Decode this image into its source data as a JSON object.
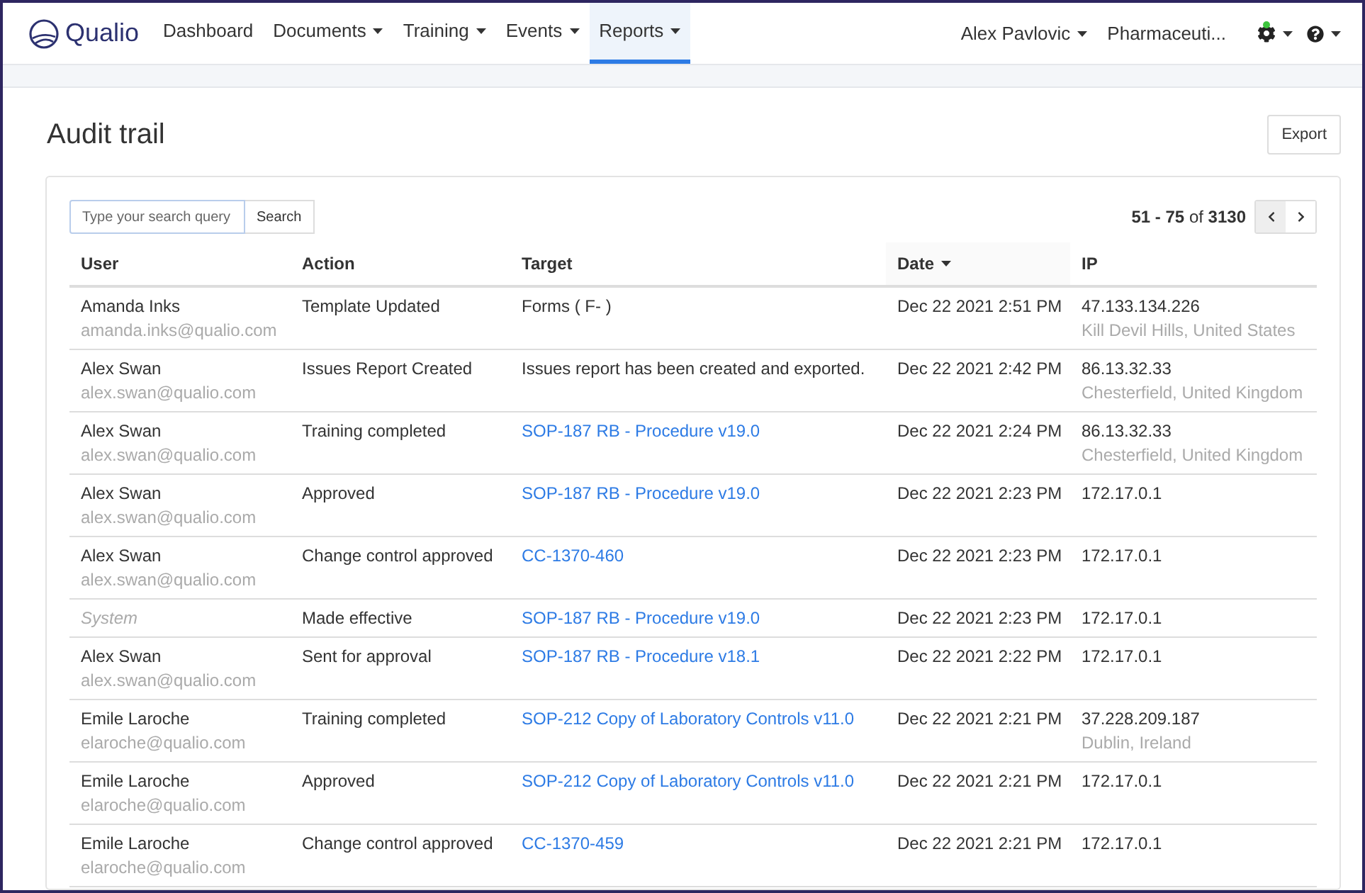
{
  "nav": {
    "brand": "Qualio",
    "items": [
      {
        "label": "Dashboard",
        "dropdown": false,
        "selected": false
      },
      {
        "label": "Documents",
        "dropdown": true,
        "selected": false
      },
      {
        "label": "Training",
        "dropdown": true,
        "selected": false
      },
      {
        "label": "Events",
        "dropdown": true,
        "selected": false
      },
      {
        "label": "Reports",
        "dropdown": true,
        "selected": true
      }
    ],
    "user": "Alex Pavlovic",
    "company": "Pharmaceuti...",
    "settings_notification": true
  },
  "page": {
    "title": "Audit trail",
    "export_button": "Export"
  },
  "search": {
    "placeholder": "Type your search query",
    "button": "Search"
  },
  "pagination": {
    "range": "**51 - 75** of **3130**",
    "prev_disabled": true
  },
  "table": {
    "columns": [
      {
        "label": "User",
        "sorted": false
      },
      {
        "label": "Action",
        "sorted": false
      },
      {
        "label": "Target",
        "sorted": false
      },
      {
        "label": "Date",
        "sorted": true
      },
      {
        "label": "IP",
        "sorted": false
      }
    ],
    "rows": [
      {
        "user": {
          "kind": "person",
          "name": "Amanda Inks",
          "email": "amanda.inks@qualio.com"
        },
        "action": "Template Updated",
        "target": {
          "kind": "text",
          "label": "Forms ( F- )"
        },
        "date": "Dec 22 2021 2:51 PM",
        "ip": "47.133.134.226",
        "location": "Kill Devil Hills, United States"
      },
      {
        "user": {
          "kind": "person",
          "name": "Alex Swan",
          "email": "alex.swan@qualio.com"
        },
        "action": "Issues Report Created",
        "target": {
          "kind": "text",
          "label": "Issues report has been created and exported."
        },
        "date": "Dec 22 2021 2:42 PM",
        "ip": "86.13.32.33",
        "location": "Chesterfield, United Kingdom"
      },
      {
        "user": {
          "kind": "person",
          "name": "Alex Swan",
          "email": "alex.swan@qualio.com"
        },
        "action": "Training completed",
        "target": {
          "kind": "link",
          "label": "SOP-187 RB - Procedure v19.0"
        },
        "date": "Dec 22 2021 2:24 PM",
        "ip": "86.13.32.33",
        "location": "Chesterfield, United Kingdom"
      },
      {
        "user": {
          "kind": "person",
          "name": "Alex Swan",
          "email": "alex.swan@qualio.com"
        },
        "action": "Approved",
        "target": {
          "kind": "link",
          "label": "SOP-187 RB - Procedure v19.0"
        },
        "date": "Dec 22 2021 2:23 PM",
        "ip": "172.17.0.1"
      },
      {
        "user": {
          "kind": "person",
          "name": "Alex Swan",
          "email": "alex.swan@qualio.com"
        },
        "action": "Change control approved",
        "target": {
          "kind": "link",
          "label": "CC-1370-460"
        },
        "date": "Dec 22 2021 2:23 PM",
        "ip": "172.17.0.1"
      },
      {
        "user": {
          "kind": "system",
          "name": "System"
        },
        "action": "Made effective",
        "target": {
          "kind": "link",
          "label": "SOP-187 RB - Procedure v19.0"
        },
        "date": "Dec 22 2021 2:23 PM",
        "ip": "172.17.0.1"
      },
      {
        "user": {
          "kind": "person",
          "name": "Alex Swan",
          "email": "alex.swan@qualio.com"
        },
        "action": "Sent for approval",
        "target": {
          "kind": "link",
          "label": "SOP-187 RB - Procedure v18.1"
        },
        "date": "Dec 22 2021 2:22 PM",
        "ip": "172.17.0.1"
      },
      {
        "user": {
          "kind": "person",
          "name": "Emile Laroche",
          "email": "elaroche@qualio.com"
        },
        "action": "Training completed",
        "target": {
          "kind": "link",
          "label": "SOP-212 Copy of Laboratory Controls v11.0"
        },
        "date": "Dec 22 2021 2:21 PM",
        "ip": "37.228.209.187",
        "location": "Dublin, Ireland"
      },
      {
        "user": {
          "kind": "person",
          "name": "Emile Laroche",
          "email": "elaroche@qualio.com"
        },
        "action": "Approved",
        "target": {
          "kind": "link",
          "label": "SOP-212 Copy of Laboratory Controls v11.0"
        },
        "date": "Dec 22 2021 2:21 PM",
        "ip": "172.17.0.1"
      },
      {
        "user": {
          "kind": "person",
          "name": "Emile Laroche",
          "email": "elaroche@qualio.com"
        },
        "action": "Change control approved",
        "target": {
          "kind": "link",
          "label": "CC-1370-459"
        },
        "date": "Dec 22 2021 2:21 PM",
        "ip": "172.17.0.1"
      }
    ]
  }
}
